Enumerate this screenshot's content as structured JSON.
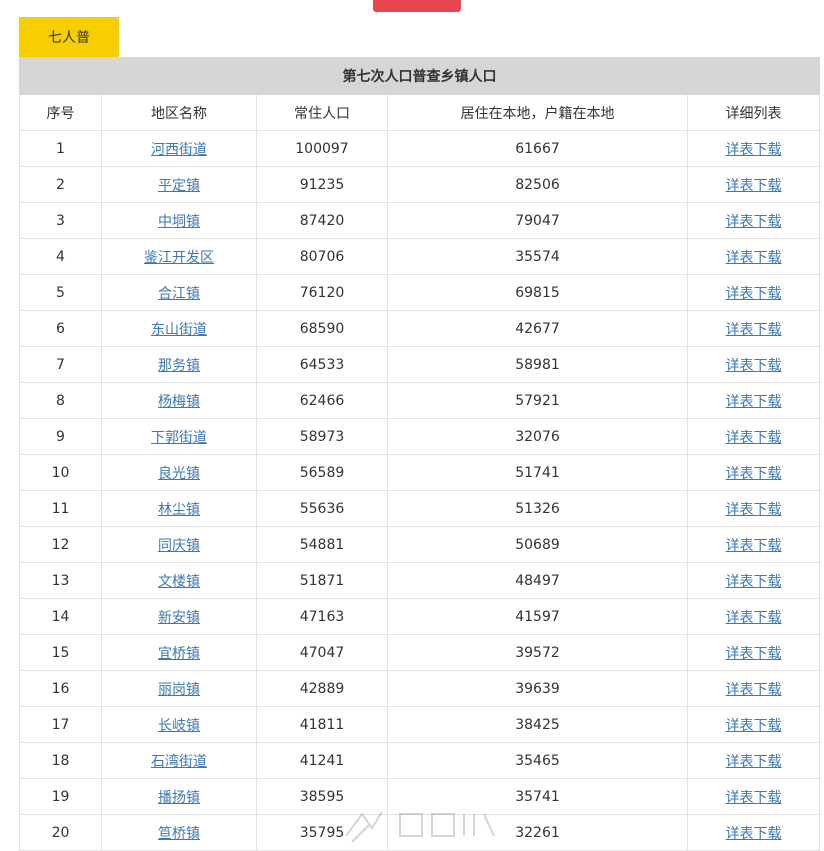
{
  "tab": {
    "label": "七人普"
  },
  "table": {
    "title": "第七次人口普查乡镇人口",
    "headers": [
      "序号",
      "地区名称",
      "常住人口",
      "居住在本地，户籍在本地",
      "详细列表"
    ],
    "rows": [
      {
        "idx": "1",
        "name": "河西街道",
        "resident": "100097",
        "local": "61667",
        "link": "详表下载"
      },
      {
        "idx": "2",
        "name": "平定镇",
        "resident": "91235",
        "local": "82506",
        "link": "详表下载"
      },
      {
        "idx": "3",
        "name": "中垌镇",
        "resident": "87420",
        "local": "79047",
        "link": "详表下载"
      },
      {
        "idx": "4",
        "name": "鉴江开发区",
        "resident": "80706",
        "local": "35574",
        "link": "详表下载"
      },
      {
        "idx": "5",
        "name": "合江镇",
        "resident": "76120",
        "local": "69815",
        "link": "详表下载"
      },
      {
        "idx": "6",
        "name": "东山街道",
        "resident": "68590",
        "local": "42677",
        "link": "详表下载"
      },
      {
        "idx": "7",
        "name": "那务镇",
        "resident": "64533",
        "local": "58981",
        "link": "详表下载"
      },
      {
        "idx": "8",
        "name": "杨梅镇",
        "resident": "62466",
        "local": "57921",
        "link": "详表下载"
      },
      {
        "idx": "9",
        "name": "下郭街道",
        "resident": "58973",
        "local": "32076",
        "link": "详表下载"
      },
      {
        "idx": "10",
        "name": "良光镇",
        "resident": "56589",
        "local": "51741",
        "link": "详表下载"
      },
      {
        "idx": "11",
        "name": "林尘镇",
        "resident": "55636",
        "local": "51326",
        "link": "详表下载"
      },
      {
        "idx": "12",
        "name": "同庆镇",
        "resident": "54881",
        "local": "50689",
        "link": "详表下载"
      },
      {
        "idx": "13",
        "name": "文楼镇",
        "resident": "51871",
        "local": "48497",
        "link": "详表下载"
      },
      {
        "idx": "14",
        "name": "新安镇",
        "resident": "47163",
        "local": "41597",
        "link": "详表下载"
      },
      {
        "idx": "15",
        "name": "宜桥镇",
        "resident": "47047",
        "local": "39572",
        "link": "详表下载"
      },
      {
        "idx": "16",
        "name": "丽岗镇",
        "resident": "42889",
        "local": "39639",
        "link": "详表下载"
      },
      {
        "idx": "17",
        "name": "长岐镇",
        "resident": "41811",
        "local": "38425",
        "link": "详表下载"
      },
      {
        "idx": "18",
        "name": "石湾街道",
        "resident": "41241",
        "local": "35465",
        "link": "详表下载"
      },
      {
        "idx": "19",
        "name": "播扬镇",
        "resident": "38595",
        "local": "35741",
        "link": "详表下载"
      },
      {
        "idx": "20",
        "name": "笪桥镇",
        "resident": "35795",
        "local": "32261",
        "link": "详表下载"
      }
    ]
  },
  "colors": {
    "tab": "#f7cf00",
    "title_bg": "#d6d6d6",
    "link": "#3b78b4",
    "badge": "#e8474f"
  }
}
